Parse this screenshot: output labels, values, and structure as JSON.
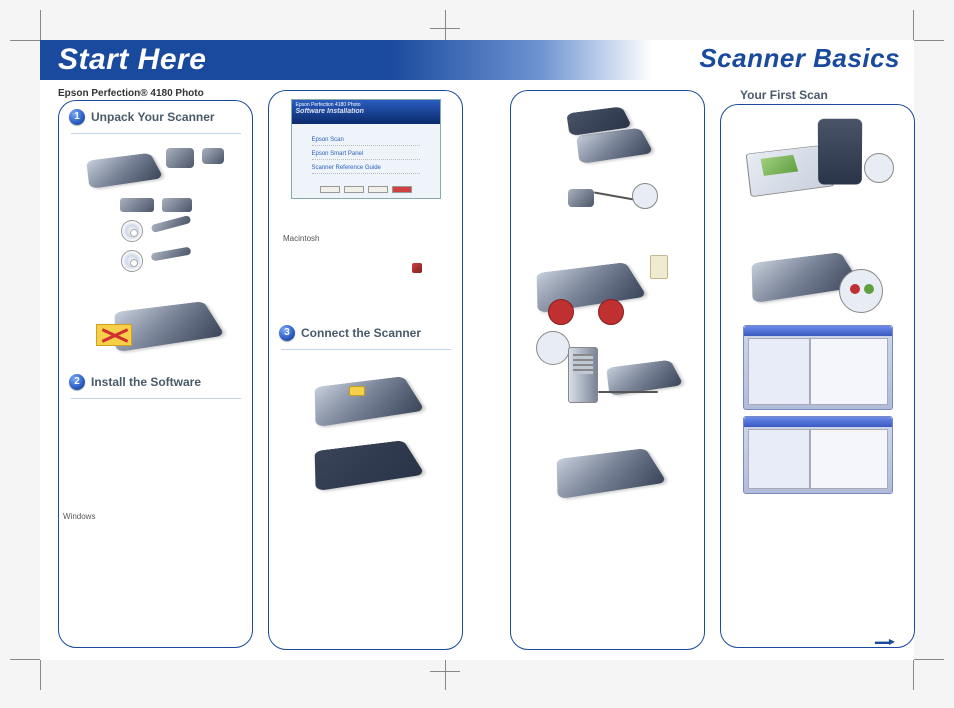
{
  "titles": {
    "start_here": "Start Here",
    "scanner_basics": "Scanner Basics"
  },
  "product_line": "Epson Perfection® 4180 Photo",
  "right_subtitle": "Your First Scan",
  "steps": {
    "s1": {
      "num": "1",
      "title": "Unpack Your Scanner"
    },
    "s2": {
      "num": "2",
      "title": "Install the Software"
    },
    "s3": {
      "num": "3",
      "title": "Connect the Scanner"
    }
  },
  "labels": {
    "windows": "Windows",
    "macintosh": "Macintosh"
  },
  "installer": {
    "header_line1": "Epson Perfection 4180 Photo",
    "header_line2": "Software Installation",
    "links": [
      "Epson Scan",
      "Epson Smart Panel",
      "Scanner Reference Guide"
    ]
  },
  "arrow": "▬▬▶"
}
